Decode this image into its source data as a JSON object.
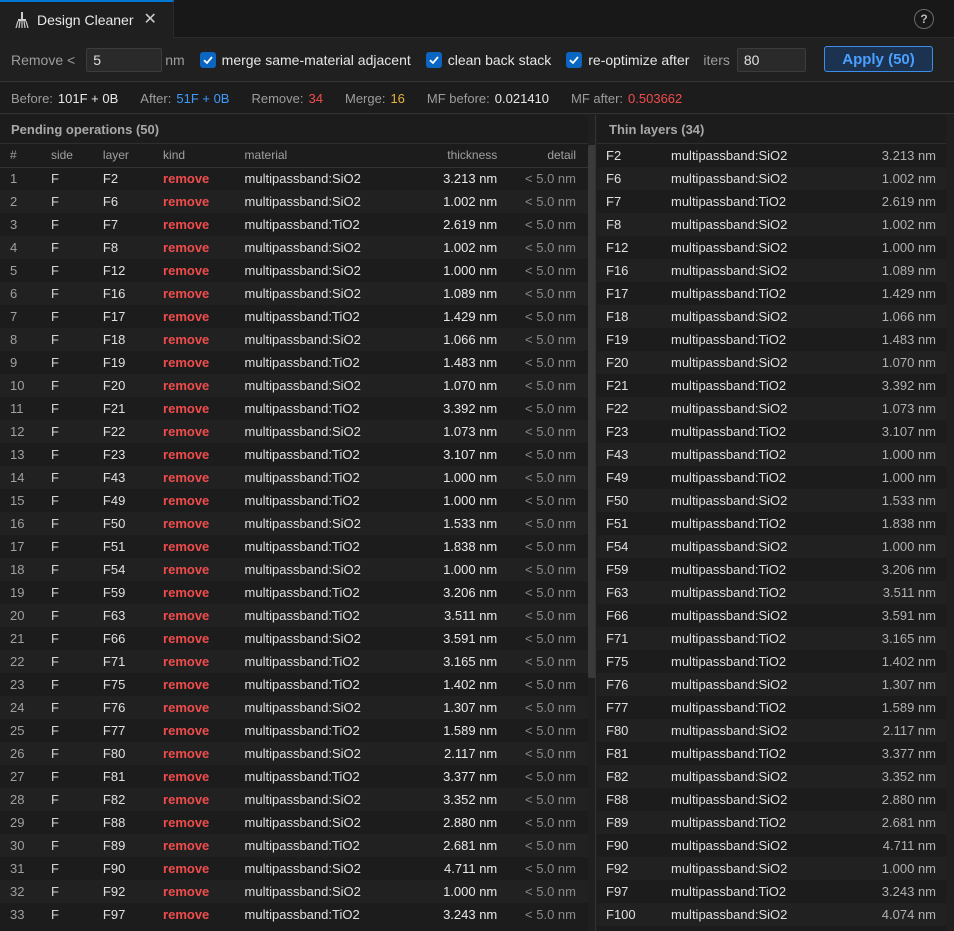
{
  "tab": {
    "title": "Design Cleaner",
    "close": "✕",
    "help": "?"
  },
  "toolbar": {
    "remove_label": "Remove <",
    "remove_value": "5",
    "remove_unit": "nm",
    "merge_label": "merge same-material adjacent",
    "clean_label": "clean back stack",
    "reopt_label": "re-optimize after",
    "iters_label": "iters",
    "iters_value": "80",
    "apply_label": "Apply (50)"
  },
  "stats": {
    "before_label": "Before:",
    "before_value": "101F + 0B",
    "after_label": "After:",
    "after_value": "51F + 0B",
    "remove_label": "Remove:",
    "remove_value": "34",
    "merge_label": "Merge:",
    "merge_value": "16",
    "mf_before_label": "MF before:",
    "mf_before_value": "0.021410",
    "mf_after_label": "MF after:",
    "mf_after_value": "0.503662"
  },
  "pending": {
    "title": "Pending operations (50)",
    "columns": [
      "#",
      "side",
      "layer",
      "kind",
      "material",
      "thickness",
      "detail"
    ],
    "rows": [
      [
        "1",
        "F",
        "F2",
        "remove",
        "multipassband:SiO2",
        "3.213 nm",
        "< 5.0 nm"
      ],
      [
        "2",
        "F",
        "F6",
        "remove",
        "multipassband:SiO2",
        "1.002 nm",
        "< 5.0 nm"
      ],
      [
        "3",
        "F",
        "F7",
        "remove",
        "multipassband:TiO2",
        "2.619 nm",
        "< 5.0 nm"
      ],
      [
        "4",
        "F",
        "F8",
        "remove",
        "multipassband:SiO2",
        "1.002 nm",
        "< 5.0 nm"
      ],
      [
        "5",
        "F",
        "F12",
        "remove",
        "multipassband:SiO2",
        "1.000 nm",
        "< 5.0 nm"
      ],
      [
        "6",
        "F",
        "F16",
        "remove",
        "multipassband:SiO2",
        "1.089 nm",
        "< 5.0 nm"
      ],
      [
        "7",
        "F",
        "F17",
        "remove",
        "multipassband:TiO2",
        "1.429 nm",
        "< 5.0 nm"
      ],
      [
        "8",
        "F",
        "F18",
        "remove",
        "multipassband:SiO2",
        "1.066 nm",
        "< 5.0 nm"
      ],
      [
        "9",
        "F",
        "F19",
        "remove",
        "multipassband:TiO2",
        "1.483 nm",
        "< 5.0 nm"
      ],
      [
        "10",
        "F",
        "F20",
        "remove",
        "multipassband:SiO2",
        "1.070 nm",
        "< 5.0 nm"
      ],
      [
        "11",
        "F",
        "F21",
        "remove",
        "multipassband:TiO2",
        "3.392 nm",
        "< 5.0 nm"
      ],
      [
        "12",
        "F",
        "F22",
        "remove",
        "multipassband:SiO2",
        "1.073 nm",
        "< 5.0 nm"
      ],
      [
        "13",
        "F",
        "F23",
        "remove",
        "multipassband:TiO2",
        "3.107 nm",
        "< 5.0 nm"
      ],
      [
        "14",
        "F",
        "F43",
        "remove",
        "multipassband:TiO2",
        "1.000 nm",
        "< 5.0 nm"
      ],
      [
        "15",
        "F",
        "F49",
        "remove",
        "multipassband:TiO2",
        "1.000 nm",
        "< 5.0 nm"
      ],
      [
        "16",
        "F",
        "F50",
        "remove",
        "multipassband:SiO2",
        "1.533 nm",
        "< 5.0 nm"
      ],
      [
        "17",
        "F",
        "F51",
        "remove",
        "multipassband:TiO2",
        "1.838 nm",
        "< 5.0 nm"
      ],
      [
        "18",
        "F",
        "F54",
        "remove",
        "multipassband:SiO2",
        "1.000 nm",
        "< 5.0 nm"
      ],
      [
        "19",
        "F",
        "F59",
        "remove",
        "multipassband:TiO2",
        "3.206 nm",
        "< 5.0 nm"
      ],
      [
        "20",
        "F",
        "F63",
        "remove",
        "multipassband:TiO2",
        "3.511 nm",
        "< 5.0 nm"
      ],
      [
        "21",
        "F",
        "F66",
        "remove",
        "multipassband:SiO2",
        "3.591 nm",
        "< 5.0 nm"
      ],
      [
        "22",
        "F",
        "F71",
        "remove",
        "multipassband:TiO2",
        "3.165 nm",
        "< 5.0 nm"
      ],
      [
        "23",
        "F",
        "F75",
        "remove",
        "multipassband:TiO2",
        "1.402 nm",
        "< 5.0 nm"
      ],
      [
        "24",
        "F",
        "F76",
        "remove",
        "multipassband:SiO2",
        "1.307 nm",
        "< 5.0 nm"
      ],
      [
        "25",
        "F",
        "F77",
        "remove",
        "multipassband:TiO2",
        "1.589 nm",
        "< 5.0 nm"
      ],
      [
        "26",
        "F",
        "F80",
        "remove",
        "multipassband:SiO2",
        "2.117 nm",
        "< 5.0 nm"
      ],
      [
        "27",
        "F",
        "F81",
        "remove",
        "multipassband:TiO2",
        "3.377 nm",
        "< 5.0 nm"
      ],
      [
        "28",
        "F",
        "F82",
        "remove",
        "multipassband:SiO2",
        "3.352 nm",
        "< 5.0 nm"
      ],
      [
        "29",
        "F",
        "F88",
        "remove",
        "multipassband:SiO2",
        "2.880 nm",
        "< 5.0 nm"
      ],
      [
        "30",
        "F",
        "F89",
        "remove",
        "multipassband:TiO2",
        "2.681 nm",
        "< 5.0 nm"
      ],
      [
        "31",
        "F",
        "F90",
        "remove",
        "multipassband:SiO2",
        "4.711 nm",
        "< 5.0 nm"
      ],
      [
        "32",
        "F",
        "F92",
        "remove",
        "multipassband:SiO2",
        "1.000 nm",
        "< 5.0 nm"
      ],
      [
        "33",
        "F",
        "F97",
        "remove",
        "multipassband:TiO2",
        "3.243 nm",
        "< 5.0 nm"
      ]
    ]
  },
  "thin": {
    "title": "Thin layers (34)",
    "rows": [
      [
        "F2",
        "multipassband:SiO2",
        "3.213 nm"
      ],
      [
        "F6",
        "multipassband:SiO2",
        "1.002 nm"
      ],
      [
        "F7",
        "multipassband:TiO2",
        "2.619 nm"
      ],
      [
        "F8",
        "multipassband:SiO2",
        "1.002 nm"
      ],
      [
        "F12",
        "multipassband:SiO2",
        "1.000 nm"
      ],
      [
        "F16",
        "multipassband:SiO2",
        "1.089 nm"
      ],
      [
        "F17",
        "multipassband:TiO2",
        "1.429 nm"
      ],
      [
        "F18",
        "multipassband:SiO2",
        "1.066 nm"
      ],
      [
        "F19",
        "multipassband:TiO2",
        "1.483 nm"
      ],
      [
        "F20",
        "multipassband:SiO2",
        "1.070 nm"
      ],
      [
        "F21",
        "multipassband:TiO2",
        "3.392 nm"
      ],
      [
        "F22",
        "multipassband:SiO2",
        "1.073 nm"
      ],
      [
        "F23",
        "multipassband:TiO2",
        "3.107 nm"
      ],
      [
        "F43",
        "multipassband:TiO2",
        "1.000 nm"
      ],
      [
        "F49",
        "multipassband:TiO2",
        "1.000 nm"
      ],
      [
        "F50",
        "multipassband:SiO2",
        "1.533 nm"
      ],
      [
        "F51",
        "multipassband:TiO2",
        "1.838 nm"
      ],
      [
        "F54",
        "multipassband:SiO2",
        "1.000 nm"
      ],
      [
        "F59",
        "multipassband:TiO2",
        "3.206 nm"
      ],
      [
        "F63",
        "multipassband:TiO2",
        "3.511 nm"
      ],
      [
        "F66",
        "multipassband:SiO2",
        "3.591 nm"
      ],
      [
        "F71",
        "multipassband:TiO2",
        "3.165 nm"
      ],
      [
        "F75",
        "multipassband:TiO2",
        "1.402 nm"
      ],
      [
        "F76",
        "multipassband:SiO2",
        "1.307 nm"
      ],
      [
        "F77",
        "multipassband:TiO2",
        "1.589 nm"
      ],
      [
        "F80",
        "multipassband:SiO2",
        "2.117 nm"
      ],
      [
        "F81",
        "multipassband:TiO2",
        "3.377 nm"
      ],
      [
        "F82",
        "multipassband:SiO2",
        "3.352 nm"
      ],
      [
        "F88",
        "multipassband:SiO2",
        "2.880 nm"
      ],
      [
        "F89",
        "multipassband:TiO2",
        "2.681 nm"
      ],
      [
        "F90",
        "multipassband:SiO2",
        "4.711 nm"
      ],
      [
        "F92",
        "multipassband:SiO2",
        "1.000 nm"
      ],
      [
        "F97",
        "multipassband:TiO2",
        "3.243 nm"
      ],
      [
        "F100",
        "multipassband:SiO2",
        "4.074 nm"
      ]
    ]
  },
  "icons": {
    "tab": "broom-icon",
    "check": "checkmark-icon",
    "help": "help-icon",
    "close": "close-icon"
  },
  "colors": {
    "accent": "#0078d4",
    "remove": "#f14c4c",
    "after": "#3d9bff",
    "merge": "#e5b33b"
  }
}
